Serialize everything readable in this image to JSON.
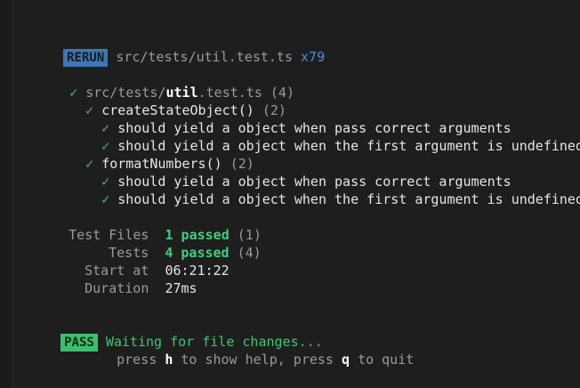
{
  "header": {
    "badge": "RERUN",
    "path": "src/tests/util.test.ts",
    "count": "x79"
  },
  "suite": {
    "check": "✓",
    "path_prefix": "src/tests/",
    "file_base": "util",
    "file_ext": ".test.ts",
    "count": "(4)"
  },
  "groups": [
    {
      "check": "✓",
      "name": "createStateObject()",
      "count": "(2)",
      "tests": [
        {
          "check": "✓",
          "label": "should yield a object when pass correct arguments"
        },
        {
          "check": "✓",
          "label": "should yield a object when the first argument is undefined"
        }
      ]
    },
    {
      "check": "✓",
      "name": "formatNumbers()",
      "count": "(2)",
      "tests": [
        {
          "check": "✓",
          "label": "should yield a object when pass correct arguments"
        },
        {
          "check": "✓",
          "label": "should yield a object when the first argument is undefined"
        }
      ]
    }
  ],
  "summary": {
    "test_files_label": "Test Files",
    "test_files_value": "1 passed",
    "test_files_total": "(1)",
    "tests_label": "Tests",
    "tests_value": "4 passed",
    "tests_total": "(4)",
    "start_label": "Start at",
    "start_value": "06:21:22",
    "duration_label": "Duration",
    "duration_value": "27ms"
  },
  "footer": {
    "badge": "PASS",
    "waiting": "Waiting for file changes...",
    "press": "press",
    "help_key": "h",
    "help_text": "to show help, press",
    "quit_key": "q",
    "quit_text": "to quit"
  },
  "colors": {
    "background": "#1e1e1e",
    "rerun_badge": "#3a78b7",
    "pass_badge": "#3bbf6d",
    "pass_text": "#39c96b",
    "count_blue": "#4a8fd8"
  }
}
